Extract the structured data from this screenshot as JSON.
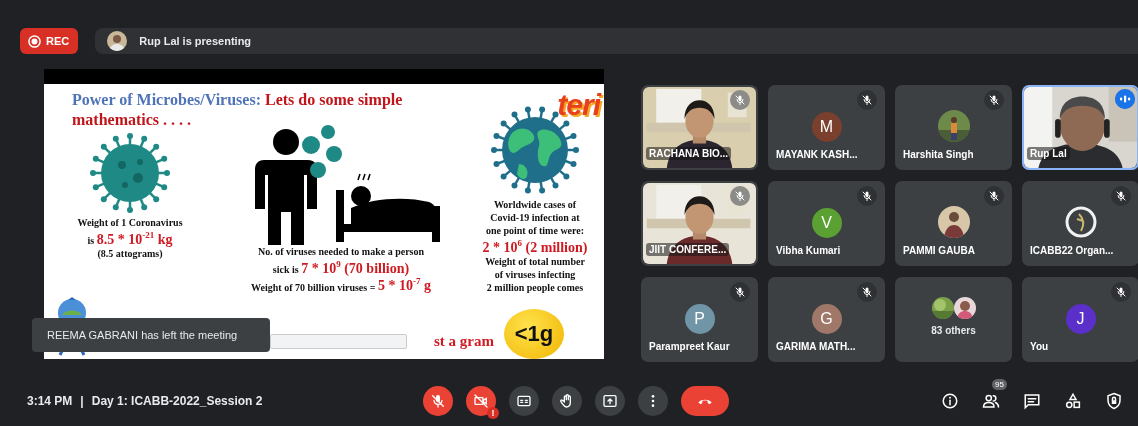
{
  "top_bar": {
    "record": "REC",
    "presenting": "Rup Lal is presenting"
  },
  "slide": {
    "title": [
      {
        "text": "Power of Microbes/Viruses: ",
        "kind": "lead"
      },
      {
        "text": "Lets do some simple mathematics . . . .",
        "kind": "accent"
      }
    ],
    "logo": "teri",
    "columns": [
      {
        "kind": "virus",
        "lines": [
          [
            {
              "text": "Weight of 1 Coronavirus",
              "kind": "note"
            }
          ],
          [
            {
              "text": "is ",
              "kind": "note"
            },
            {
              "text": "8.5 * 10$^{-21}$ kg",
              "kind": "value"
            }
          ],
          [
            {
              "text": "(8.5 attograms)",
              "kind": "note"
            }
          ]
        ]
      },
      {
        "kind": "people",
        "lines": [
          [
            {
              "text": "No. of viruses needed to make a person",
              "kind": "note"
            }
          ],
          [
            {
              "text": "sick is ",
              "kind": "note"
            },
            {
              "text": "7 * 10$^{9}$ (70 billion)",
              "kind": "value"
            }
          ],
          [
            {
              "text": "Weight of 70 billion viruses = ",
              "kind": "note"
            },
            {
              "text": "5 * 10$^{-7}$ g",
              "kind": "value"
            }
          ]
        ]
      },
      {
        "kind": "globe",
        "lines": [
          [
            {
              "text": "Worldwide cases of",
              "kind": "note"
            }
          ],
          [
            {
              "text": "Covid-19 infection at",
              "kind": "note"
            }
          ],
          [
            {
              "text": "one point of time were:",
              "kind": "note"
            }
          ],
          [
            {
              "text": "2 * 10$^{6}$ (2 million)",
              "kind": "value"
            }
          ],
          [
            {
              "text": "Weight of total number",
              "kind": "note"
            }
          ],
          [
            {
              "text": "of viruses infecting",
              "kind": "note"
            }
          ],
          [
            {
              "text": "2 million people  comes",
              "kind": "note"
            }
          ]
        ]
      }
    ],
    "footer": {
      "text": "st a gram",
      "badge": "<1g"
    }
  },
  "toast": "REEMA GABRANI has left the meeting",
  "tiles": [
    {
      "name": "RACHANA BIO...",
      "kind": "camera",
      "muted": true,
      "speaking": false
    },
    {
      "name": "MAYANK KASH...",
      "kind": "initial",
      "initial": "M",
      "color": "#7b3f2e",
      "muted": true,
      "speaking": false
    },
    {
      "name": "Harshita Singh",
      "muted": true,
      "speaking": false
    },
    {
      "name": "Rup Lal",
      "kind": "camera",
      "muted": false,
      "speaking": true
    },
    {
      "name": "JIIT CONFERE...",
      "kind": "camera",
      "muted": true,
      "speaking": false
    },
    {
      "name": "Vibha Kumari",
      "kind": "initial",
      "initial": "V",
      "color": "#5aa032",
      "muted": true,
      "speaking": false
    },
    {
      "name": "PAMMI GAUBA",
      "muted": true,
      "speaking": false
    },
    {
      "name": "ICABB22 Organ...",
      "kind": "emblem",
      "muted": true,
      "speaking": false
    },
    {
      "name": "Parampreet Kaur",
      "kind": "initial",
      "initial": "P",
      "color": "#6f95a6",
      "muted": true,
      "speaking": false
    },
    {
      "name": "GARIMA MATH...",
      "kind": "initial",
      "initial": "G",
      "color": "#a0786a",
      "muted": true,
      "speaking": false
    },
    {
      "name": "83 others",
      "kind": "group",
      "muted": false,
      "speaking": false
    },
    {
      "name": "You",
      "kind": "initial",
      "initial": "J",
      "color": "#5b2fc9",
      "muted": true,
      "speaking": false
    }
  ],
  "bottom_bar": {
    "time": "3:14 PM",
    "separator": "|",
    "meeting": "Day 1: ICABB-2022_Session 2",
    "controls": [
      {
        "kind": "mic",
        "on": false
      },
      {
        "kind": "camera",
        "on": false,
        "alert": "!"
      },
      {
        "kind": "captions"
      },
      {
        "kind": "hand"
      },
      {
        "kind": "present"
      },
      {
        "kind": "more"
      },
      {
        "kind": "leave"
      }
    ],
    "tools": [
      {
        "kind": "info"
      },
      {
        "kind": "people",
        "badge": "95"
      },
      {
        "kind": "chat"
      },
      {
        "kind": "activities"
      },
      {
        "kind": "host"
      }
    ]
  }
}
